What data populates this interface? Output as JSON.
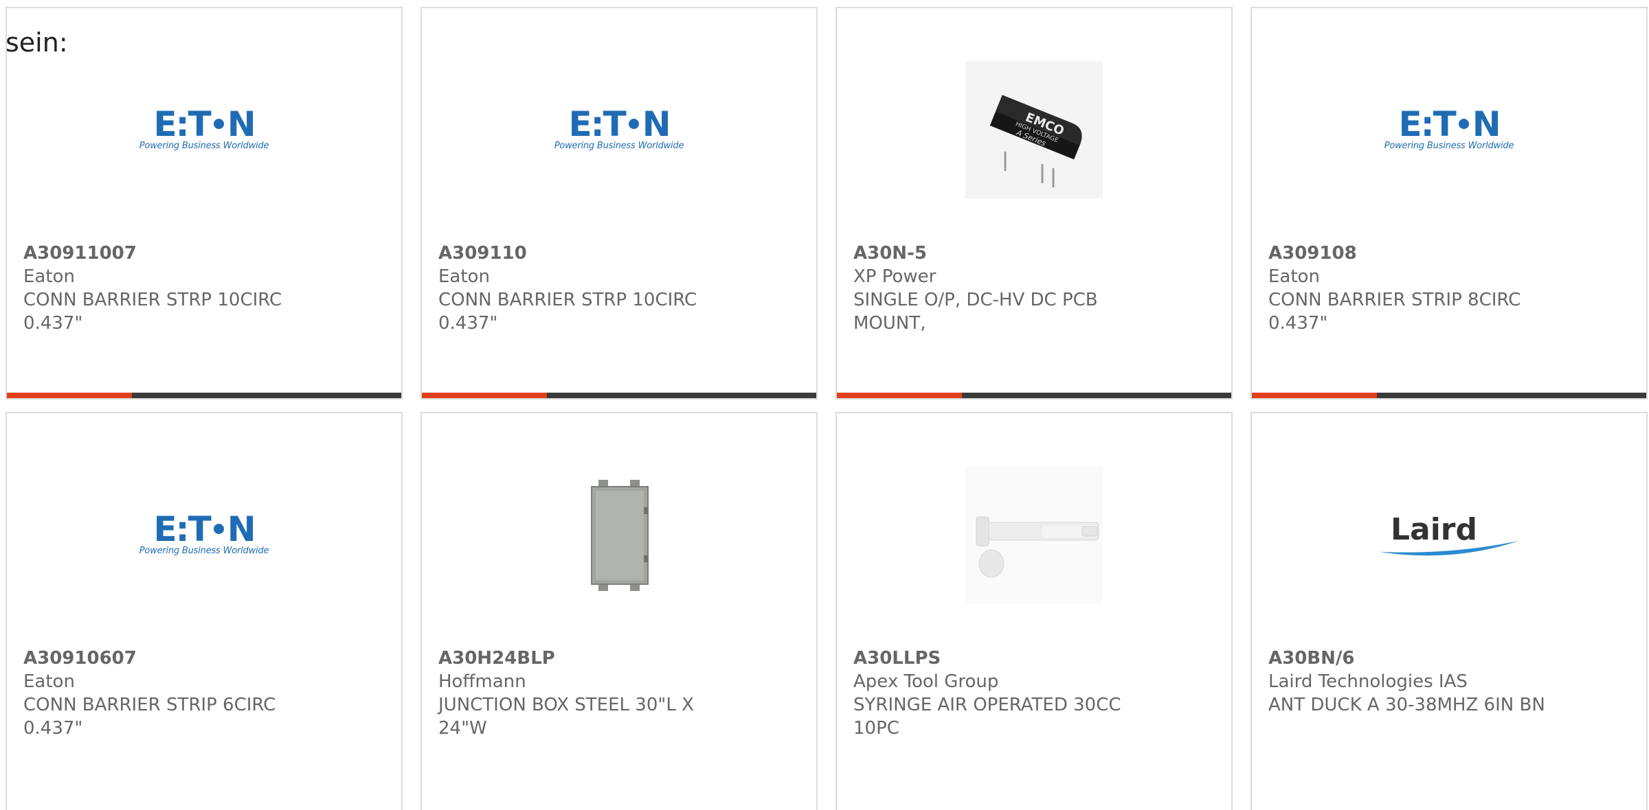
{
  "intro_text": "sein:",
  "logo_eaton": {
    "mark_left": "E",
    "mark_mid": "T",
    "mark_right": "N",
    "tagline": "Powering Business Worldwide"
  },
  "logo_laird": {
    "word": "Laird"
  },
  "colors": {
    "accent": "#e0401c",
    "bar": "#3a3a3a",
    "text": "#666666",
    "eaton_blue": "#1f6cb5",
    "laird_blue": "#2a8bd0"
  },
  "products": [
    {
      "part": "A30911007",
      "maker": "Eaton",
      "desc1": "CONN BARRIER STRP 10CIRC",
      "desc2": "0.437\"",
      "image": "eaton-logo"
    },
    {
      "part": "A309110",
      "maker": "Eaton",
      "desc1": "CONN BARRIER STRP 10CIRC",
      "desc2": "0.437\"",
      "image": "eaton-logo"
    },
    {
      "part": "A30N-5",
      "maker": "XP Power",
      "desc1": "SINGLE O/P, DC-HV DC PCB",
      "desc2": "MOUNT,",
      "image": "emco-module",
      "emco_label": "EMCO",
      "emco_sub1": "HIGH VOLTAGE",
      "emco_sub2": "A Series"
    },
    {
      "part": "A309108",
      "maker": "Eaton",
      "desc1": "CONN BARRIER STRIP 8CIRC",
      "desc2": "0.437\"",
      "image": "eaton-logo"
    },
    {
      "part": "A30910607",
      "maker": "Eaton",
      "desc1": "CONN BARRIER STRIP 6CIRC",
      "desc2": "0.437\"",
      "image": "eaton-logo"
    },
    {
      "part": "A30H24BLP",
      "maker": "Hoffmann",
      "desc1": "JUNCTION BOX STEEL 30\"L X",
      "desc2": "24\"W",
      "image": "junction-box"
    },
    {
      "part": "A30LLPS",
      "maker": "Apex Tool Group",
      "desc1": "SYRINGE AIR OPERATED 30CC",
      "desc2": "10PC",
      "image": "syringe"
    },
    {
      "part": "A30BN/6",
      "maker": "Laird Technologies IAS",
      "desc1": "ANT DUCK A 30-38MHZ 6IN BN",
      "desc2": "",
      "image": "laird-logo"
    }
  ]
}
